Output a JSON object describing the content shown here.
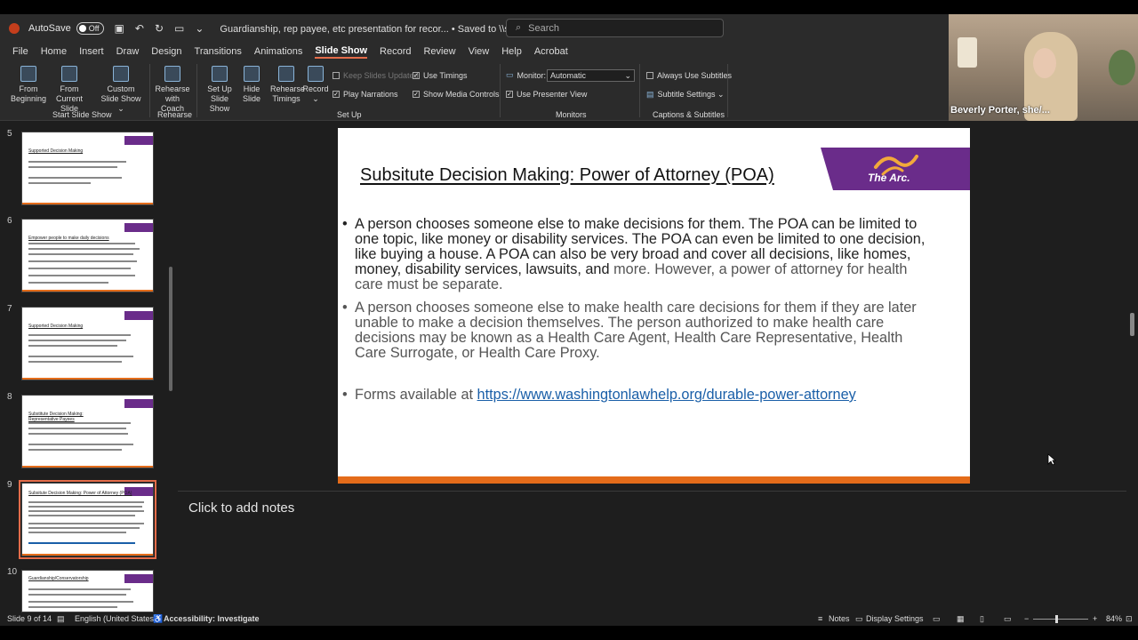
{
  "titlebar": {
    "autosave": "AutoSave",
    "autosave_state": "Off",
    "doc_title": "Guardianship, rep payee, etc presentation for recor...  •  Saved to \\\\server\\Work In Progress ⌄",
    "search_placeholder": "Search"
  },
  "menu": [
    "File",
    "Home",
    "Insert",
    "Draw",
    "Design",
    "Transitions",
    "Animations",
    "Slide Show",
    "Record",
    "Review",
    "View",
    "Help",
    "Acrobat"
  ],
  "ribbon": {
    "from_beginning": "From Beginning",
    "from_current": "From Current Slide",
    "custom_show": "Custom Slide Show ⌄",
    "group_start": "Start Slide Show",
    "rehearse_coach": "Rehearse with Coach",
    "group_rehearse": "Rehearse",
    "setup_show": "Set Up Slide Show",
    "hide_slide": "Hide Slide",
    "rehearse_timings": "Rehearse Timings",
    "record": "Record ⌄",
    "keep_updated": "Keep Slides Updated",
    "play_narrations": "Play Narrations",
    "use_timings": "Use Timings",
    "show_media": "Show Media Controls",
    "group_setup": "Set Up",
    "monitor_label": "Monitor:",
    "monitor_value": "Automatic",
    "use_presenter": "Use Presenter View",
    "group_monitors": "Monitors",
    "always_subtitles": "Always Use Subtitles",
    "subtitle_settings": "Subtitle Settings ⌄",
    "group_captions": "Captions & Subtitles"
  },
  "video": {
    "name": "Beverly Porter, she/..."
  },
  "thumbnails": [
    {
      "num": "5",
      "title": "Supported Decision Making"
    },
    {
      "num": "6",
      "title": "Empower people to make daily decisions"
    },
    {
      "num": "7",
      "title": "Supported Decision Making"
    },
    {
      "num": "8",
      "title": "Substitute Decision Making: Representative Payees"
    },
    {
      "num": "9",
      "title": "Subsitute Decision Making: Power of Attorney (POA)"
    },
    {
      "num": "10",
      "title": "Guardianship/Conservatorship"
    }
  ],
  "slide": {
    "title": "Subsitute Decision Making: Power of Attorney (POA)",
    "logo": "The Arc.",
    "bullet1_dark": "A person chooses someone else to make decisions for them. The POA can be limited to one topic, like money or disability services. The POA can even be limited to one decision, like buying a house. A POA can also be very broad and cover all decisions, like homes, money, disability services, lawsuits, and",
    "bullet1_gray": " more. However, a power of attorney for health care must be separate.",
    "bullet2": "A person chooses someone else to make health care decisions for them if they are later unable to make a decision themselves. The person authorized to make health care decisions may be known as a Health Care Agent, Health Care Representative, Health Care Surrogate, or Health Care Proxy.",
    "bullet3_prefix": "Forms available at ",
    "bullet3_link": "https://www.washingtonlawhelp.org/durable-power-attorney"
  },
  "notes": {
    "placeholder": "Click to add notes"
  },
  "status": {
    "slide_count": "Slide 9 of 14",
    "language": "English (United States)",
    "accessibility": "Accessibility: Investigate",
    "notes": "Notes",
    "display_settings": "Display Settings",
    "zoom": "84%"
  },
  "colors": {
    "accent": "#e46c4a",
    "arc_purple": "#6a2c8a",
    "arc_orange": "#e46c1a",
    "link": "#1a5fa8"
  }
}
